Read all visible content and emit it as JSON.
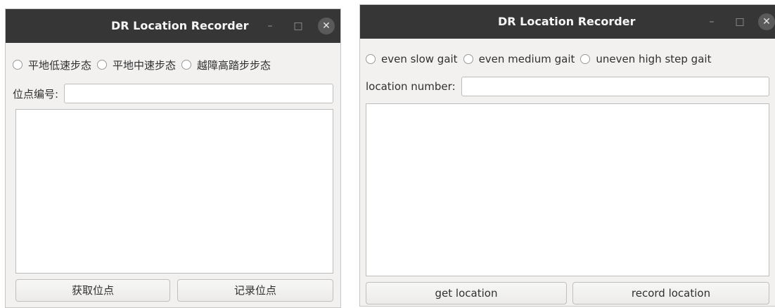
{
  "windows": [
    {
      "title": "DR Location Recorder",
      "titlebar_controls": {
        "minimize": "–",
        "maximize": "□",
        "close": "✕"
      },
      "gait_options": [
        {
          "label": "平地低速步态",
          "selected": false
        },
        {
          "label": "平地中速步态",
          "selected": false
        },
        {
          "label": "越障高踏步步态",
          "selected": false
        }
      ],
      "location_label": "位点编号:",
      "location_value": "",
      "buttons": {
        "get": "获取位点",
        "record": "记录位点"
      }
    },
    {
      "title": "DR Location Recorder",
      "titlebar_controls": {
        "minimize": "–",
        "maximize": "□",
        "close": "✕"
      },
      "gait_options": [
        {
          "label": "even slow gait",
          "selected": false
        },
        {
          "label": "even medium gait",
          "selected": false
        },
        {
          "label": "uneven high step gait",
          "selected": false
        }
      ],
      "location_label": "location number:",
      "location_value": "",
      "buttons": {
        "get": "get location",
        "record": "record location"
      }
    }
  ],
  "colors": {
    "titlebar": "#363636",
    "window_bg": "#f2f1f0",
    "field_bg": "#ffffff"
  }
}
